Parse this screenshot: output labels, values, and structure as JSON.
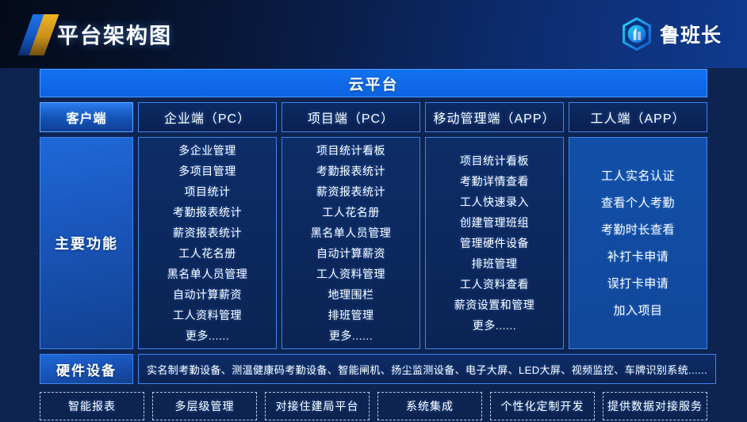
{
  "header": {
    "title": "平台架构图",
    "logo_icon": "slash-logo-icon",
    "brand_icon": "luban-hexagon-building-icon",
    "brand_name": "鲁班长"
  },
  "cloud_bar": {
    "label": "云平台"
  },
  "row_labels": {
    "client": "客户端",
    "features": "主要功能",
    "hardware": "硬件设备"
  },
  "columns": [
    {
      "header": "企业端（PC）",
      "items": [
        "多企业管理",
        "多项目管理",
        "项目统计",
        "考勤报表统计",
        "薪资报表统计",
        "工人花名册",
        "黑名单人员管理",
        "自动计算薪资",
        "工人资料管理",
        "更多......"
      ]
    },
    {
      "header": "项目端（PC）",
      "items": [
        "项目统计看板",
        "考勤报表统计",
        "薪资报表统计",
        "工人花名册",
        "黑名单人员管理",
        "自动计算薪资",
        "工人资料管理",
        "地理围栏",
        "排班管理",
        "更多......"
      ]
    },
    {
      "header": "移动管理端（APP）",
      "items": [
        "项目统计看板",
        "考勤详情查看",
        "工人快速录入",
        "创建管理班组",
        "管理硬件设备",
        "排班管理",
        "工人资料查看",
        "薪资设置和管理",
        "更多......"
      ]
    },
    {
      "header": "工人端（APP）",
      "items": [
        "工人实名认证",
        "查看个人考勤",
        "考勤时长查看",
        "补打卡申请",
        "误打卡申请",
        "加入项目"
      ]
    }
  ],
  "hardware_text": "实名制考勤设备、测温健康码考勤设备、智能闸机、扬尘监测设备、电子大屏、LED大屏、视频监控、车牌识别系统......",
  "tags": [
    "智能报表",
    "多层级管理",
    "对接住建局平台",
    "系统集成",
    "个性化定制开发",
    "提供数据对接服务"
  ],
  "colors": {
    "page_background": "#0d2451",
    "accent_blue": "#1272f0",
    "border_blue": "#3d84f0",
    "panel_dark": "#0e2c66",
    "panel_light": "#1250a8",
    "logo_gold": "#f0b323",
    "text_white": "#ffffff"
  }
}
